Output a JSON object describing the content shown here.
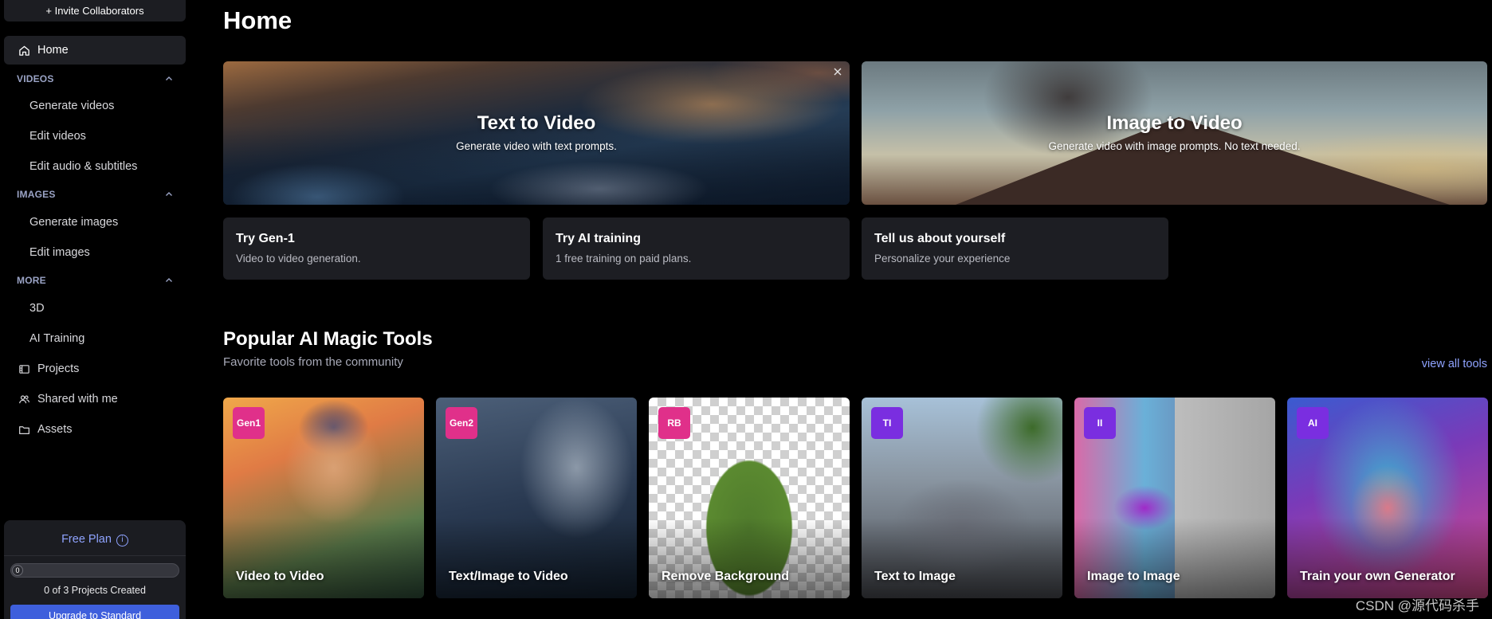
{
  "sidebar": {
    "invite_label": "+ Invite Collaborators",
    "home_label": "Home",
    "videos": {
      "heading": "VIDEOS",
      "items": [
        "Generate videos",
        "Edit videos",
        "Edit audio & subtitles"
      ]
    },
    "images": {
      "heading": "IMAGES",
      "items": [
        "Generate images",
        "Edit images"
      ]
    },
    "more": {
      "heading": "MORE",
      "items": [
        "3D",
        "AI Training"
      ]
    },
    "projects_label": "Projects",
    "shared_label": "Shared with me",
    "assets_label": "Assets",
    "plan": {
      "title": "Free Plan",
      "progress_value": "0",
      "progress_fraction": 0,
      "projects_created": "0 of 3 Projects Created",
      "upgrade_label": "Upgrade to Standard"
    }
  },
  "main": {
    "title": "Home",
    "heroes": [
      {
        "title": "Text to Video",
        "subtitle": "Generate video with text prompts."
      },
      {
        "title": "Image to Video",
        "subtitle": "Generate video with image prompts. No text needed."
      }
    ],
    "info_cards": [
      {
        "title": "Try Gen-1",
        "subtitle": "Video to video generation."
      },
      {
        "title": "Try AI training",
        "subtitle": "1 free training on paid plans."
      },
      {
        "title": "Tell us about yourself",
        "subtitle": "Personalize your experience"
      }
    ],
    "tools_section": {
      "title": "Popular AI Magic Tools",
      "subtitle": "Favorite tools from the community",
      "view_all_label": "view all tools"
    },
    "tools": [
      {
        "badge": "Gen1",
        "label": "Video to Video",
        "badge_color": "#e0308a"
      },
      {
        "badge": "Gen2",
        "label": "Text/Image to Video",
        "badge_color": "#e0308a"
      },
      {
        "badge": "RB",
        "label": "Remove Background",
        "badge_color": "#e0308a"
      },
      {
        "badge": "TI",
        "label": "Text to Image",
        "badge_color": "#7a2ee0"
      },
      {
        "badge": "II",
        "label": "Image to Image",
        "badge_color": "#7a2ee0"
      },
      {
        "badge": "AI",
        "label": "Train your own Generator",
        "badge_color": "#7a2ee0"
      }
    ]
  },
  "watermark": "CSDN @源代码杀手",
  "colors": {
    "accent": "#8fa3ff",
    "upgrade": "#3e5fdc",
    "background": "#000000",
    "card": "#1d1e23"
  }
}
